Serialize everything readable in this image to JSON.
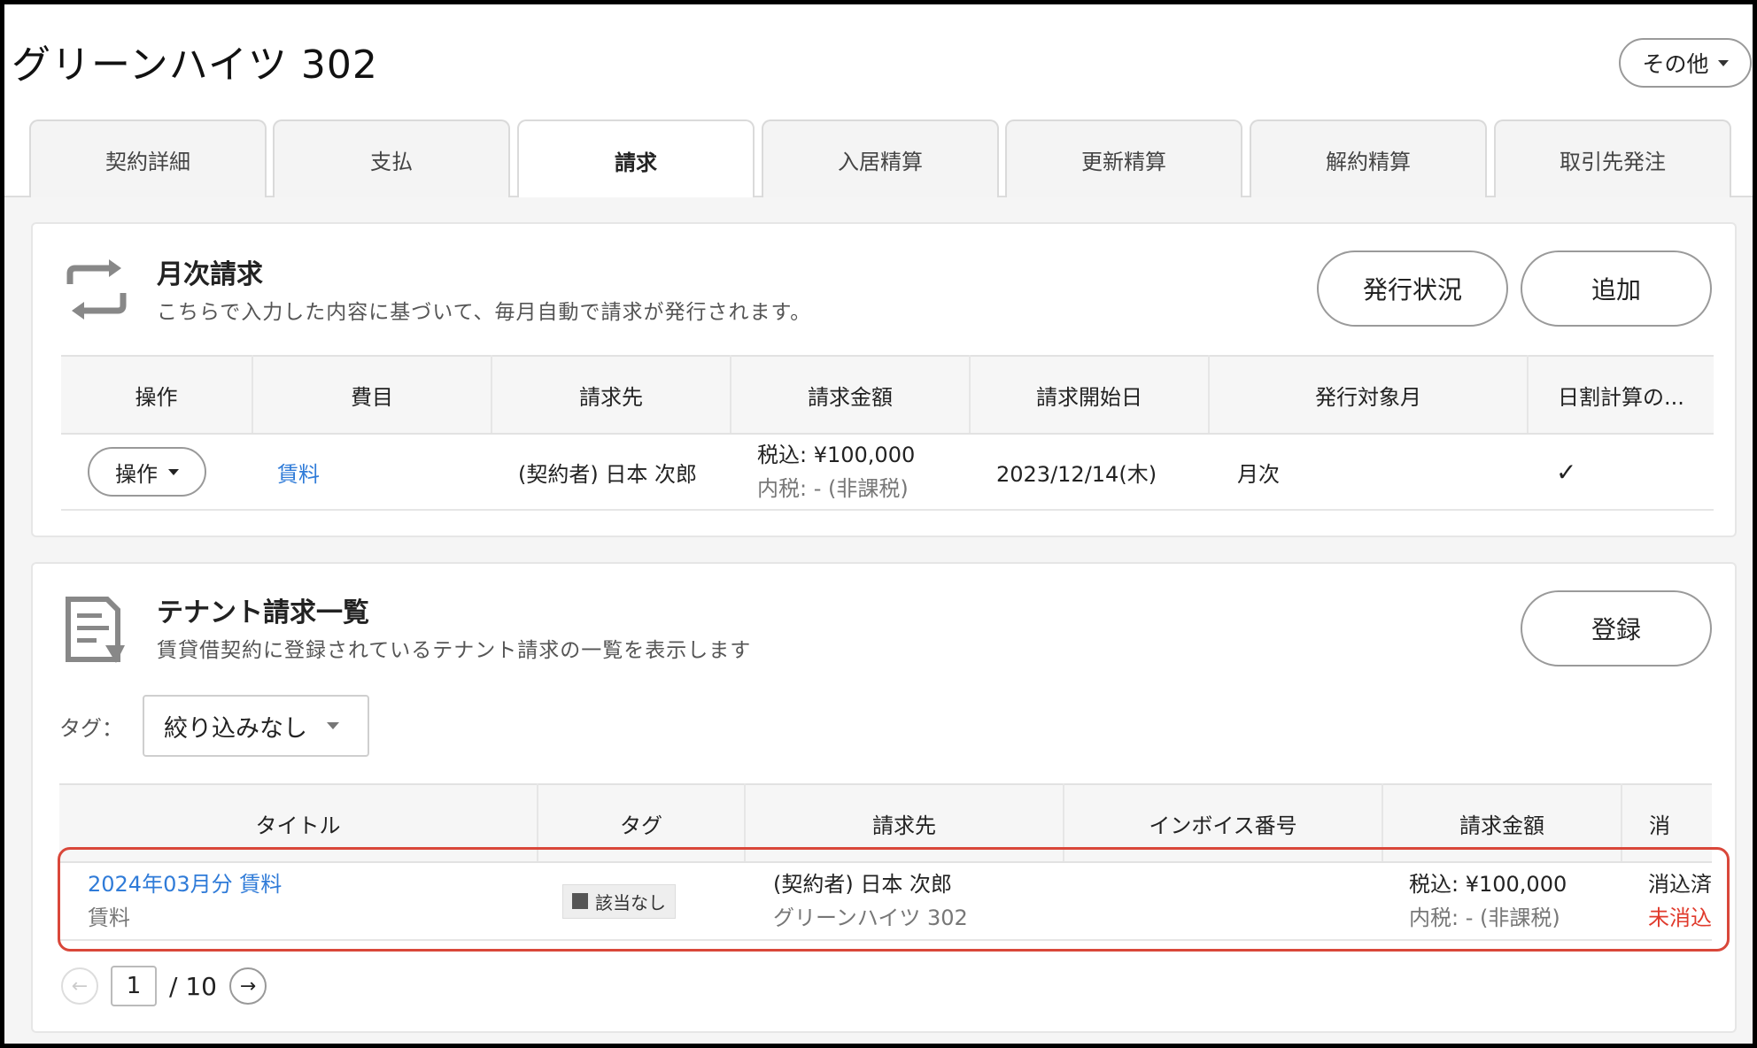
{
  "header": {
    "title": "グリーンハイツ 302",
    "more_label": "その他"
  },
  "tabs": [
    {
      "label": "契約詳細",
      "active": false
    },
    {
      "label": "支払",
      "active": false
    },
    {
      "label": "請求",
      "active": true
    },
    {
      "label": "入居精算",
      "active": false
    },
    {
      "label": "更新精算",
      "active": false
    },
    {
      "label": "解約精算",
      "active": false
    },
    {
      "label": "取引先発注",
      "active": false
    }
  ],
  "monthly": {
    "icon": "repeat-icon",
    "title": "月次請求",
    "desc": "こちらで入力した内容に基づいて、毎月自動で請求が発行されます。",
    "status_btn": "発行状況",
    "add_btn": "追加",
    "columns": [
      "操作",
      "費目",
      "請求先",
      "請求金額",
      "請求開始日",
      "発行対象月",
      "日割計算の..."
    ],
    "rows": [
      {
        "op": "操作",
        "item": "賃料",
        "billto": "(契約者) 日本 次郎",
        "amount": "税込: ¥100,000",
        "tax": "内税: - (非課税)",
        "start": "2023/12/14(木)",
        "month": "月次",
        "prorate": "✓"
      }
    ]
  },
  "tenant": {
    "icon": "document-icon",
    "title": "テナント請求一覧",
    "desc": "賃貸借契約に登録されているテナント請求の一覧を表示します",
    "register_btn": "登録",
    "tag_label": "タグ：",
    "tag_filter": "絞り込みなし",
    "columns": [
      "タイトル",
      "タグ",
      "請求先",
      "インボイス番号",
      "請求金額",
      "消"
    ],
    "rows": [
      {
        "title": "2024年03月分 賃料",
        "subtitle": "賃料",
        "tag": "該当なし",
        "billto": "(契約者) 日本 次郎",
        "property": "グリーンハイツ 302",
        "invoice": "",
        "amount": "税込: ¥100,000",
        "tax": "内税: - (非課税)",
        "status1": "消込済",
        "status2": "未消込"
      }
    ],
    "pager": {
      "current": "1",
      "total": "/ 10"
    }
  },
  "colors": {
    "link": "#2f7bd8",
    "alert": "#e03a2c",
    "highlight": "#d9473a"
  }
}
